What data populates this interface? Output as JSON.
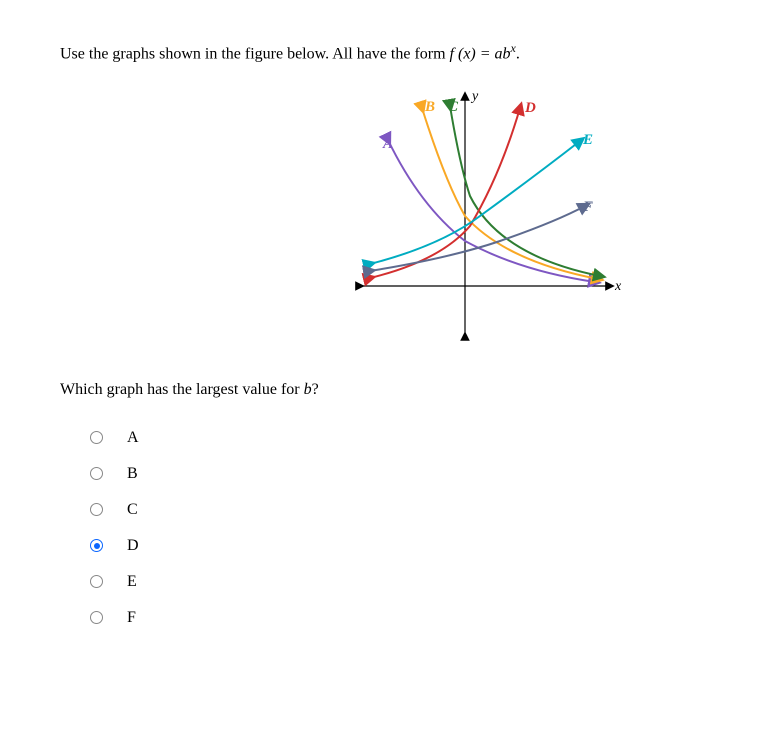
{
  "instruction_prefix": "Use the graphs shown in the figure below. All have the form ",
  "function_form": "f (x) = ab",
  "function_exponent": "x",
  "instruction_suffix": ".",
  "axis_y": "y",
  "axis_x": "x",
  "curve_labels": {
    "A": "A",
    "B": "B",
    "C": "C",
    "D": "D",
    "E": "E",
    "F": "F"
  },
  "question_prefix": "Which graph has the largest value for ",
  "question_var": "b",
  "question_suffix": "?",
  "options": [
    "A",
    "B",
    "C",
    "D",
    "E",
    "F"
  ],
  "selected": "D",
  "chart_data": {
    "type": "line",
    "title": "",
    "xlabel": "x",
    "ylabel": "y",
    "series": [
      {
        "name": "A",
        "color": "#7e57c2",
        "description": "decreasing exponential, steep, upper left to lower right"
      },
      {
        "name": "B",
        "color": "#f9a825",
        "description": "decreasing exponential, moderate, upper middle-left to lower right"
      },
      {
        "name": "C",
        "color": "#2e7d32",
        "description": "decreasing exponential, shallow, upper middle to lower right near axis"
      },
      {
        "name": "D",
        "color": "#d32f2f",
        "description": "increasing exponential, steep, lower left to upper right"
      },
      {
        "name": "E",
        "color": "#00acc1",
        "description": "increasing exponential, moderate, lower left to upper right"
      },
      {
        "name": "F",
        "color": "#5e6b8f",
        "description": "increasing exponential, shallow, lower left to right near axis"
      }
    ],
    "xlim": [
      -3,
      3
    ],
    "ylim": [
      -1,
      4
    ]
  }
}
